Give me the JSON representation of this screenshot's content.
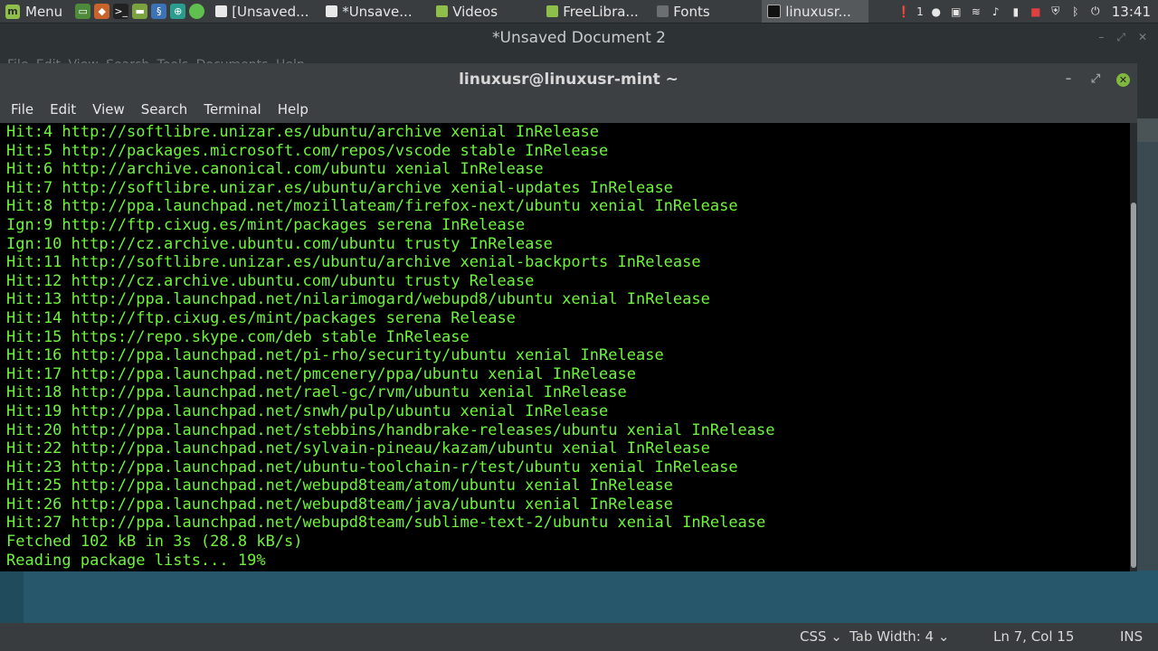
{
  "panel": {
    "menu_label": "Menu",
    "tasks": [
      {
        "label": "[Unsaved...",
        "icon": "text-editor-icon"
      },
      {
        "label": "*Unsave...",
        "icon": "text-editor-icon"
      },
      {
        "label": "Videos",
        "icon": "folder-icon"
      },
      {
        "label": "FreeLibra...",
        "icon": "folder-icon"
      },
      {
        "label": "Fonts",
        "icon": "font-viewer-icon"
      },
      {
        "label": "linuxusr...",
        "icon": "terminal-icon"
      }
    ],
    "tray_badge": "1",
    "clock": "13:41"
  },
  "editor": {
    "title": "*Unsaved Document 2",
    "menu_ghost": "File  Edit  View  Search  Tools  Documents  Help",
    "status": {
      "language": "CSS",
      "tab_width": "Tab Width: 4",
      "position": "Ln 7, Col 15",
      "mode": "INS"
    }
  },
  "terminal": {
    "title": "linuxusr@linuxusr-mint ~",
    "menu": [
      "File",
      "Edit",
      "View",
      "Search",
      "Terminal",
      "Help"
    ],
    "lines": [
      "Hit:4 http://softlibre.unizar.es/ubuntu/archive xenial InRelease",
      "Hit:5 http://packages.microsoft.com/repos/vscode stable InRelease",
      "Hit:6 http://archive.canonical.com/ubuntu xenial InRelease",
      "Hit:7 http://softlibre.unizar.es/ubuntu/archive xenial-updates InRelease",
      "Hit:8 http://ppa.launchpad.net/mozillateam/firefox-next/ubuntu xenial InRelease",
      "Ign:9 http://ftp.cixug.es/mint/packages serena InRelease",
      "Ign:10 http://cz.archive.ubuntu.com/ubuntu trusty InRelease",
      "Hit:11 http://softlibre.unizar.es/ubuntu/archive xenial-backports InRelease",
      "Hit:12 http://cz.archive.ubuntu.com/ubuntu trusty Release",
      "Hit:13 http://ppa.launchpad.net/nilarimogard/webupd8/ubuntu xenial InRelease",
      "Hit:14 http://ftp.cixug.es/mint/packages serena Release",
      "Hit:15 https://repo.skype.com/deb stable InRelease",
      "Hit:16 http://ppa.launchpad.net/pi-rho/security/ubuntu xenial InRelease",
      "Hit:17 http://ppa.launchpad.net/pmcenery/ppa/ubuntu xenial InRelease",
      "Hit:18 http://ppa.launchpad.net/rael-gc/rvm/ubuntu xenial InRelease",
      "Hit:19 http://ppa.launchpad.net/snwh/pulp/ubuntu xenial InRelease",
      "Hit:20 http://ppa.launchpad.net/stebbins/handbrake-releases/ubuntu xenial InRelease",
      "Hit:22 http://ppa.launchpad.net/sylvain-pineau/kazam/ubuntu xenial InRelease",
      "Hit:23 http://ppa.launchpad.net/ubuntu-toolchain-r/test/ubuntu xenial InRelease",
      "Hit:25 http://ppa.launchpad.net/webupd8team/atom/ubuntu xenial InRelease",
      "Hit:26 http://ppa.launchpad.net/webupd8team/java/ubuntu xenial InRelease",
      "Hit:27 http://ppa.launchpad.net/webupd8team/sublime-text-2/ubuntu xenial InRelease",
      "Fetched 102 kB in 3s (28.8 kB/s)",
      "Reading package lists... 19%"
    ]
  },
  "colors": {
    "terminal_text": "#6ef53b",
    "terminal_bg": "#000000",
    "panel_bg": "#3a3d3f",
    "accent_green": "#80b83f"
  }
}
